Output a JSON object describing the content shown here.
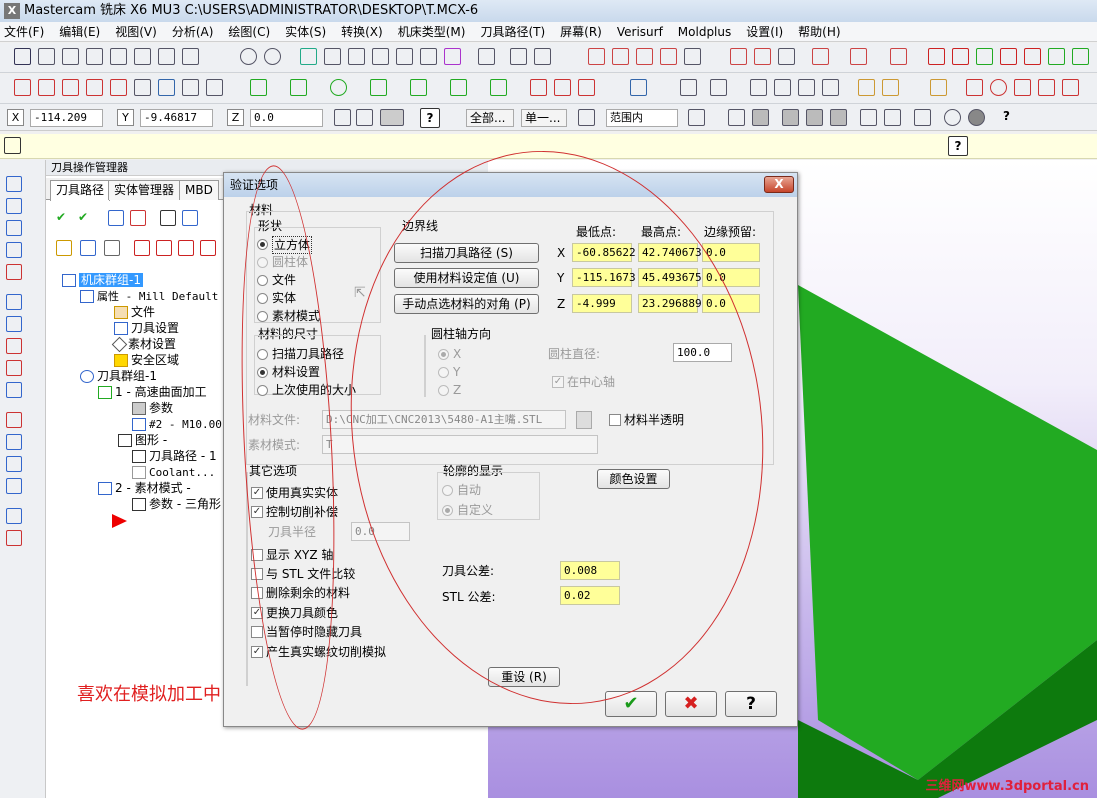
{
  "app": {
    "logo": "X",
    "title": "Mastercam 铣床 X6 MU3  C:\\USERS\\ADMINISTRATOR\\DESKTOP\\T.MCX-6"
  },
  "menu": [
    "文件(F)",
    "编辑(E)",
    "视图(V)",
    "分析(A)",
    "绘图(C)",
    "实体(S)",
    "转换(X)",
    "机床类型(M)",
    "刀具路径(T)",
    "屏幕(R)",
    "Verisurf",
    "Moldplus",
    "设置(I)",
    "帮助(H)"
  ],
  "coords": {
    "x_label": "X",
    "x_value": "-114.209",
    "y_label": "Y",
    "y_value": "-9.46817",
    "z_label": "Z",
    "z_value": "0.0",
    "all_label": "全部...",
    "single_label": "单一...",
    "range_label": "范围内"
  },
  "yellowbar": {
    "help": "?"
  },
  "ops_manager": {
    "title": "刀具操作管理器",
    "tabs": [
      "刀具路径",
      "实体管理器",
      "MBD"
    ],
    "tree": [
      "机床群组-1",
      "属性 - Mill Default",
      "文件",
      "刀具设置",
      "素材设置",
      "安全区域",
      "刀具群组-1",
      "1 - 高速曲面加工",
      "参数",
      "#2 - M10.00",
      "图形 -",
      "刀具路径 - 1",
      "Coolant...",
      "2 - 素材模式 -",
      "参数 - 三角形"
    ]
  },
  "dialog": {
    "title": "验证选项",
    "close": "X",
    "material": {
      "group": "材料",
      "shape_group": "形状",
      "shapes": [
        "立方体",
        "圆柱体",
        "文件",
        "实体",
        "素材模式"
      ],
      "size_group": "材料的尺寸",
      "sizes": [
        "扫描刀具路径",
        "材料设置",
        "上次使用的大小"
      ],
      "boundary": "边界线",
      "scan_button": "扫描刀具路径 (S)",
      "use_material_button": "使用材料设定值 (U)",
      "manual_button": "手动点选材料的对角 (P)",
      "col_min": "最低点:",
      "col_max": "最高点:",
      "col_margin": "边缘预留:",
      "rows": [
        {
          "axis": "X",
          "min": "-60.85622",
          "max": "42.740673",
          "margin": "0.0"
        },
        {
          "axis": "Y",
          "min": "-115.1673",
          "max": "45.493675",
          "margin": "0.0"
        },
        {
          "axis": "Z",
          "min": "-4.999",
          "max": "23.296889",
          "margin": "0.0"
        }
      ],
      "cyl_group": "圆柱轴方向",
      "cyl_axes": [
        "X",
        "Y",
        "Z"
      ],
      "cyl_diameter_label": "圆柱直径:",
      "cyl_diameter": "100.0",
      "cyl_center": "在中心轴",
      "material_file_label": "材料文件:",
      "material_file": "D:\\CNC加工\\CNC2013\\5480-A1主嘴.STL",
      "translucent": "材料半透明",
      "stock_mode_label": "素材模式:",
      "stock_mode": "T"
    },
    "other": {
      "group": "其它选项",
      "options": [
        "使用真实实体",
        "控制切削补偿"
      ],
      "tool_radius_label": "刀具半径",
      "tool_radius": "0.0",
      "more": [
        "显示 XYZ 轴",
        "与 STL 文件比较",
        "删除剩余的材料",
        "更换刀具颜色",
        "当暂停时隐藏刀具",
        "产生真实螺纹切削模拟"
      ]
    },
    "profile": {
      "group": "轮廓的显示",
      "options": [
        "自动",
        "自定义"
      ]
    },
    "color_button": "颜色设置",
    "tolerances": {
      "tool_label": "刀具公差:",
      "tool": "0.008",
      "stl_label": "STL 公差:",
      "stl": "0.02"
    },
    "reset": "重设 (R)",
    "ok": "✔",
    "cancel": "✖",
    "help": "?"
  },
  "caption": "喜欢在模拟加工中自由换.",
  "watermark": "三维网www.3dportal.cn"
}
